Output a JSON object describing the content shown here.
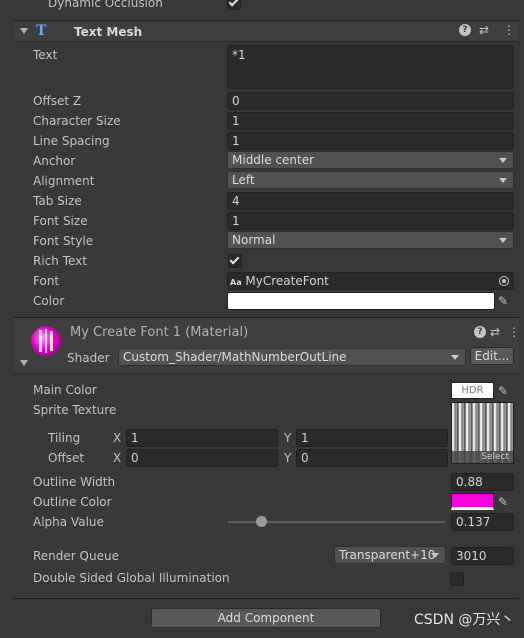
{
  "top_row": {
    "label": "Dynamic Occlusion"
  },
  "text_mesh": {
    "title": "Text Mesh",
    "fields": {
      "text": {
        "label": "Text",
        "value": "*1"
      },
      "offset_z": {
        "label": "Offset Z",
        "value": "0"
      },
      "character_size": {
        "label": "Character Size",
        "value": "1"
      },
      "line_spacing": {
        "label": "Line Spacing",
        "value": "1"
      },
      "anchor": {
        "label": "Anchor",
        "value": "Middle center"
      },
      "alignment": {
        "label": "Alignment",
        "value": "Left"
      },
      "tab_size": {
        "label": "Tab Size",
        "value": "4"
      },
      "font_size": {
        "label": "Font Size",
        "value": "1"
      },
      "font_style": {
        "label": "Font Style",
        "value": "Normal"
      },
      "rich_text": {
        "label": "Rich Text",
        "checked": true
      },
      "font": {
        "label": "Font",
        "value": "MyCreateFont",
        "icon_text": "Aa"
      },
      "color": {
        "label": "Color",
        "value": "#ffffff"
      }
    }
  },
  "material": {
    "title": "My Create Font 1 (Material)",
    "shader_label": "Shader",
    "shader_value": "Custom_Shader/MathNumberOutLine",
    "edit_label": "Edit...",
    "main_color": {
      "label": "Main Color",
      "badge": "HDR"
    },
    "sprite_texture": {
      "label": "Sprite Texture",
      "select_label": "Select"
    },
    "tiling": {
      "label": "Tiling",
      "x_label": "X",
      "x": "1",
      "y_label": "Y",
      "y": "1"
    },
    "offset": {
      "label": "Offset",
      "x_label": "X",
      "x": "0",
      "y_label": "Y",
      "y": "0"
    },
    "outline_width": {
      "label": "Outline Width",
      "value": "0.88"
    },
    "outline_color": {
      "label": "Outline Color",
      "value": "#ff00dc"
    },
    "alpha_value": {
      "label": "Alpha Value",
      "value": "0.137",
      "slider_fraction": 0.153
    },
    "render_queue": {
      "label": "Render Queue",
      "preset": "Transparent+10",
      "value": "3010"
    },
    "double_sided_gi": {
      "label": "Double Sided Global Illumination",
      "checked": false
    }
  },
  "add_component": {
    "label": "Add Component"
  },
  "watermark": {
    "text": "CSDN @万兴丶"
  },
  "colors": {
    "accent_magenta": "#ff00dc",
    "panel": "#383838",
    "field": "#2a2a2a"
  }
}
